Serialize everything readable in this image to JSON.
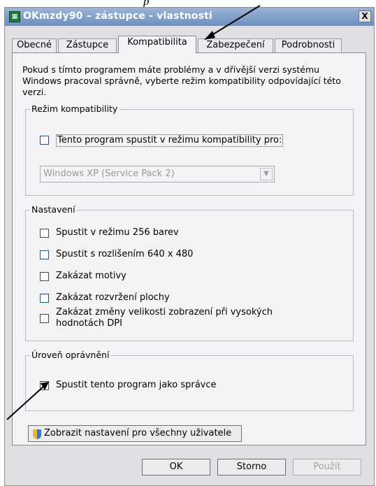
{
  "annotation_text": "p",
  "window": {
    "title": "OKmzdy90 – zástupce - vlastnosti",
    "close_label": "X"
  },
  "tabs": [
    {
      "label": "Obecné"
    },
    {
      "label": "Zástupce"
    },
    {
      "label": "Kompatibilita",
      "active": true
    },
    {
      "label": "Zabezpečení"
    },
    {
      "label": "Podrobnosti"
    }
  ],
  "intro_text": "Pokud s tímto programem máte problémy a v dřívější verzi systému Windows pracoval správně, vyberte režim kompatibility odpovídající této verzi.",
  "compat_group": {
    "title": "Režim kompatibility",
    "checkbox_label": "Tento program spustit v režimu kompatibility pro:",
    "checked": false,
    "select_value": "Windows XP (Service Pack 2)"
  },
  "settings_group": {
    "title": "Nastavení",
    "items": [
      {
        "label": "Spustit v režimu 256 barev",
        "checked": false
      },
      {
        "label": "Spustit s rozlišením 640 x 480",
        "checked": false
      },
      {
        "label": "Zakázat motivy",
        "checked": false
      },
      {
        "label": "Zakázat rozvržení plochy",
        "checked": false
      },
      {
        "label": "Zakázat změny velikosti zobrazení při vysokých hodnotách DPI",
        "checked": false
      }
    ]
  },
  "privilege_group": {
    "title": "Úroveň oprávnění",
    "checkbox_label": "Spustit tento program jako správce",
    "checked": true
  },
  "all_users_button": "Zobrazit nastavení pro všechny uživatele",
  "footer": {
    "ok": "OK",
    "cancel": "Storno",
    "apply": "Použít"
  },
  "colors": {
    "titlebar": "#6f8fbd",
    "dialog_bg": "#e0dfe3",
    "panel_bg": "#f4f3f6",
    "checkbox_border": "#1c5180"
  }
}
